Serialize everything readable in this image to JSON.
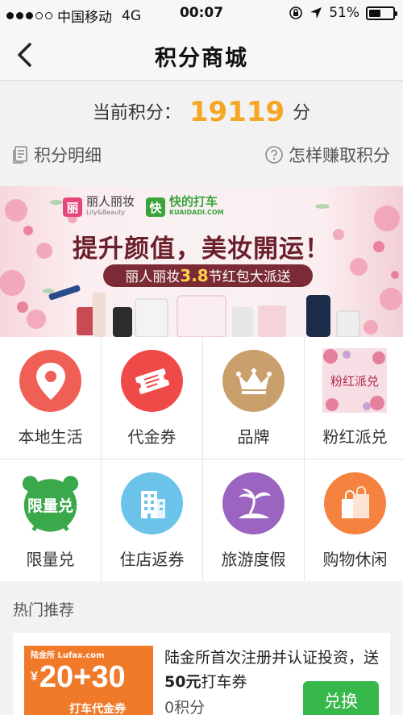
{
  "status_bar": {
    "carrier": "中国移动",
    "network": "4G",
    "time": "00:07",
    "battery": "51%",
    "battery_level": 0.51
  },
  "nav": {
    "title": "积分商城",
    "back_icon": "chevron-left-icon"
  },
  "points": {
    "label": "当前积分：",
    "value": "19119",
    "unit": "分",
    "detail_link": "积分明细",
    "earn_link": "怎样赚取积分"
  },
  "banner": {
    "brand_1": "丽人丽妆",
    "brand_1_en": "Lily&Beauty",
    "brand_1_mark": "丽",
    "brand_2": "快的打车",
    "brand_2_en": "KUAIDADI.COM",
    "brand_2_mark": "快",
    "headline": "提升颜值，美妆開运！",
    "sub_prefix": "丽人丽妆",
    "sub_highlight": "3.8",
    "sub_suffix": "节红包大派送"
  },
  "categories": [
    {
      "label": "本地生活",
      "icon": "location-pin-icon",
      "color": "#ef5f55"
    },
    {
      "label": "代金券",
      "icon": "ticket-icon",
      "color": "#ef4a47"
    },
    {
      "label": "品牌",
      "icon": "crown-icon",
      "color": "#c9a06b"
    },
    {
      "label": "粉红派兑",
      "icon": "pink-exchange-image",
      "color": "#e88aa0",
      "image_text": "粉红派兑"
    },
    {
      "label": "限量兑",
      "icon": "alarm-clock-icon",
      "color": "#3aa94b",
      "image_text": "限量兑"
    },
    {
      "label": "住店返券",
      "icon": "hotel-building-icon",
      "color": "#6cc3ea"
    },
    {
      "label": "旅游度假",
      "icon": "palm-island-icon",
      "color": "#9a64c0"
    },
    {
      "label": "购物休闲",
      "icon": "shopping-bags-icon",
      "color": "#f6823f"
    }
  ],
  "hot": {
    "title": "热门推荐",
    "item": {
      "thumb_brand": "陆金所 Lufax.com",
      "thumb_amount": "20+30",
      "thumb_currency": "¥",
      "thumb_sub": "打车代金券",
      "desc_1": "陆金所首次注册并认证投资，送",
      "desc_bold": "50元",
      "desc_2": "打车券",
      "points": "0积分",
      "button": "兑换"
    }
  }
}
